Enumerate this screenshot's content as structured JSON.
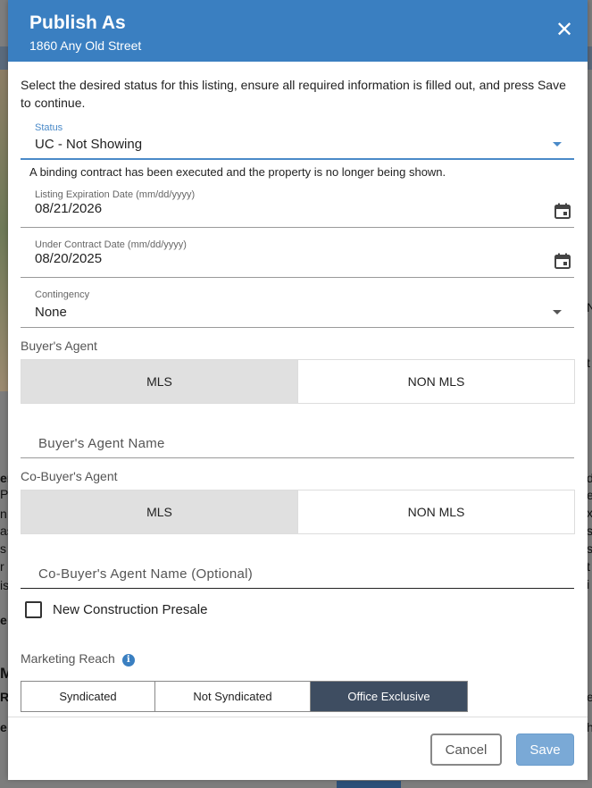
{
  "background": {
    "texts": [
      "N",
      "t",
      "er",
      "P",
      "n",
      "as",
      "s",
      "r",
      "is",
      "e",
      "M",
      "R",
      "e",
      "d",
      "e",
      "x",
      "s",
      "s",
      "t",
      "i",
      "e",
      "h"
    ]
  },
  "modal": {
    "title": "Publish As",
    "subtitle": "1860 Any Old Street",
    "intro": "Select the desired status for this listing, ensure all required information is filled out, and press Save to continue.",
    "status": {
      "label": "Status",
      "value": "UC - Not Showing",
      "help": "A binding contract has been executed and the property is no longer being shown."
    },
    "expiration": {
      "label": "Listing Expiration Date (mm/dd/yyyy)",
      "value": "08/21/2026"
    },
    "under_contract": {
      "label": "Under Contract Date (mm/dd/yyyy)",
      "value": "08/20/2025"
    },
    "contingency": {
      "label": "Contingency",
      "value": "None"
    },
    "buyers_agent": {
      "label": "Buyer's Agent",
      "options": [
        "MLS",
        "NON MLS"
      ],
      "selected": "MLS",
      "name_placeholder": "Buyer's Agent Name"
    },
    "co_buyers_agent": {
      "label": "Co-Buyer's Agent",
      "options": [
        "MLS",
        "NON MLS"
      ],
      "selected": "MLS",
      "name_placeholder": "Co-Buyer's Agent Name (Optional)"
    },
    "new_construction": {
      "label": "New Construction Presale",
      "checked": false
    },
    "marketing_reach": {
      "label": "Marketing Reach",
      "options": [
        "Syndicated",
        "Not Syndicated",
        "Office Exclusive"
      ],
      "selected": "Office Exclusive"
    },
    "footer": {
      "cancel_label": "Cancel",
      "save_label": "Save"
    }
  },
  "colors": {
    "header": "#3a7fc1",
    "accent": "#4a8ac8",
    "selected_segment": "#3e4d61",
    "save_button": "#7aa9d6"
  },
  "icons": [
    "close-icon",
    "calendar-icon",
    "chevron-down-icon",
    "info-icon"
  ]
}
